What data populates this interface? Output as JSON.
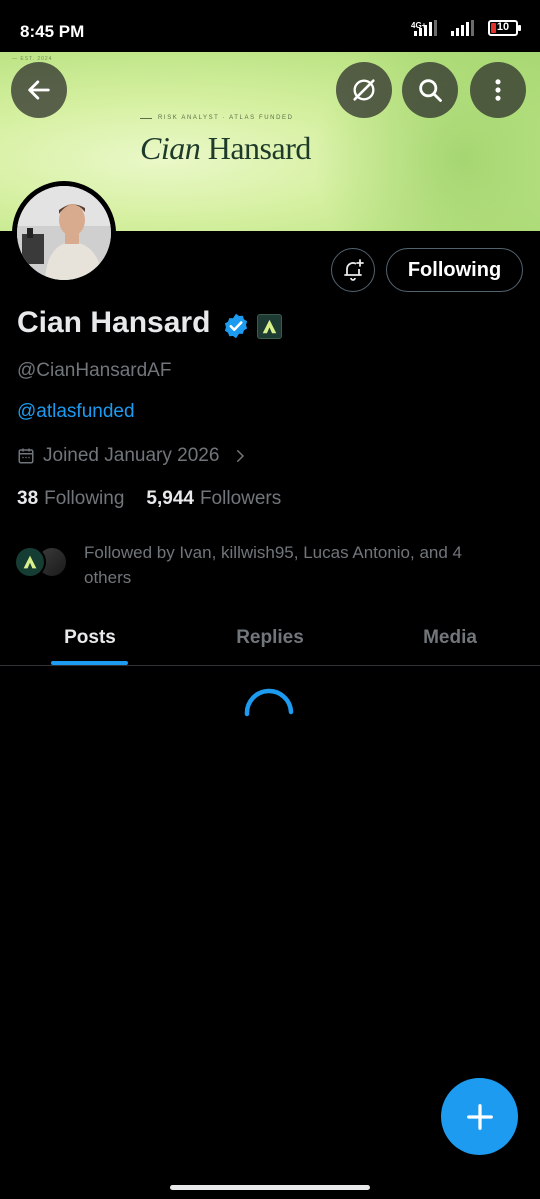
{
  "status_bar": {
    "time": "8:45 PM",
    "network": "4G+",
    "battery": "10"
  },
  "banner": {
    "est_text": "— EST. 2024",
    "subtitle": "RISK ANALYST · ATLAS FUNDED",
    "first_name": "Cian",
    "last_name": "Hansard"
  },
  "profile": {
    "display_name": "Cian Hansard",
    "handle": "@CianHansardAF",
    "bio_link": "@atlasfunded",
    "joined": "Joined January 2026",
    "following_count": "38",
    "following_label": "Following",
    "followers_count": "5,944",
    "followers_label": "Followers",
    "followed_by": "Followed by Ivan, killwish95, Lucas Antonio, and 4 others"
  },
  "actions": {
    "following_button": "Following"
  },
  "tabs": [
    {
      "label": "Posts",
      "active": true
    },
    {
      "label": "Replies",
      "active": false
    },
    {
      "label": "Media",
      "active": false
    }
  ],
  "colors": {
    "accent": "#1d9bf0",
    "background": "#000000",
    "secondary_text": "#71767b",
    "banner_green": "#d5f0a0"
  },
  "icons": [
    "back-arrow-icon",
    "grok-icon",
    "search-icon",
    "more-vertical-icon",
    "bell-plus-icon",
    "verified-badge-icon",
    "affiliate-badge-icon",
    "calendar-icon",
    "chevron-right-icon",
    "loading-spinner-icon",
    "plus-icon"
  ]
}
